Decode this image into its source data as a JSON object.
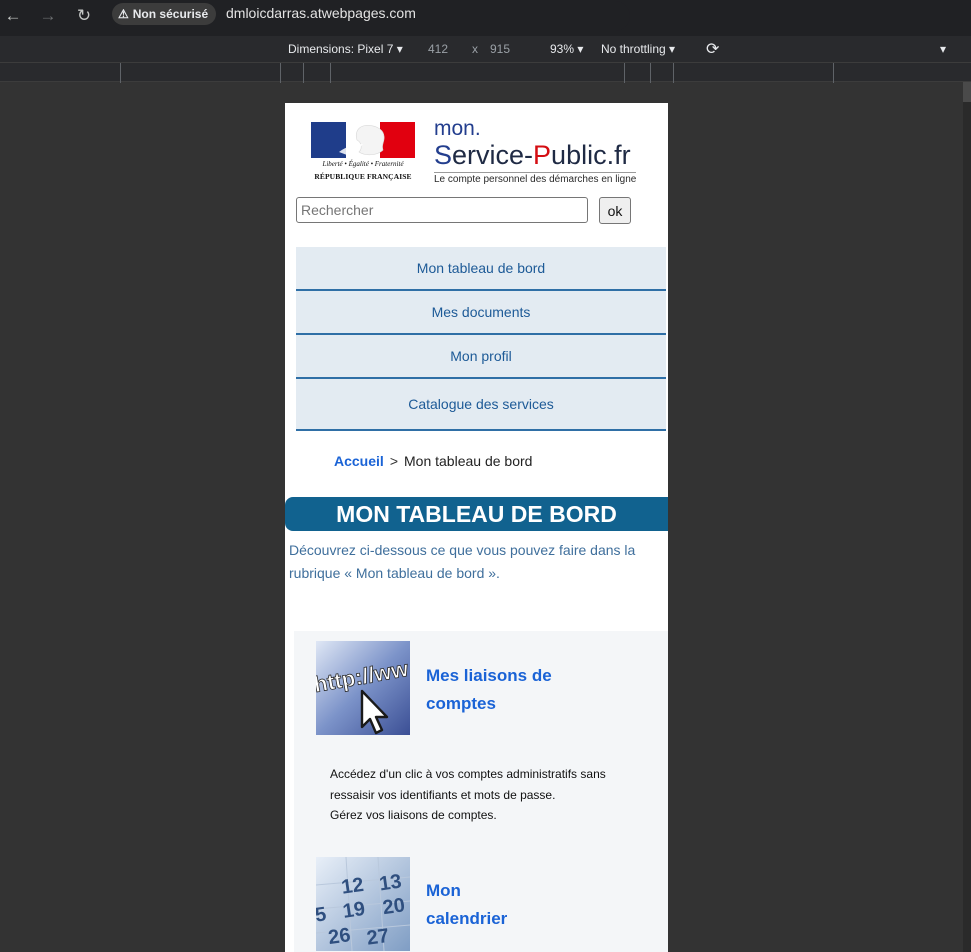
{
  "browser": {
    "security_label": "Non sécurisé",
    "url": "dmloicdarras.atwebpages.com"
  },
  "devtools": {
    "dimensions_label": "Dimensions: Pixel 7",
    "width": "412",
    "times": "x",
    "height": "915",
    "zoom": "93%",
    "throttling": "No throttling"
  },
  "header": {
    "rf_motto": "Liberté • Égalité • Fraternité",
    "rf_name": "RÉPUBLIQUE FRANÇAISE",
    "logo_mon": "mon.",
    "logo_s": "S",
    "logo_ervice": "ervice-",
    "logo_p": "P",
    "logo_ublic": "ublic.fr",
    "logo_tagline": "Le compte personnel des démarches en ligne"
  },
  "search": {
    "placeholder": "Rechercher",
    "button_label": "ok"
  },
  "nav": {
    "items": [
      {
        "label": "Mon tableau de bord"
      },
      {
        "label": "Mes documents"
      },
      {
        "label": "Mon profil"
      },
      {
        "label": "Catalogue des services"
      }
    ]
  },
  "breadcrumb": {
    "home": "Accueil",
    "separator": ">",
    "current": "Mon tableau de bord"
  },
  "page": {
    "title": "MON TABLEAU DE BORD",
    "intro": "Découvrez ci-dessous ce que vous pouvez faire dans la rubrique « Mon tableau de bord »."
  },
  "services": [
    {
      "icon": "http-link-icon",
      "title": "Mes liaisons de comptes",
      "desc_lines": [
        "Accédez d'un clic à vos comptes administratifs sans",
        "ressaisir vos identifiants et mots de passe.",
        "Gérez vos liaisons de comptes."
      ]
    },
    {
      "icon": "calendar-icon",
      "title_line1": "Mon",
      "title_line2": "calendrier"
    }
  ],
  "icon_text": {
    "http": "http://ww",
    "cal_n1": "12",
    "cal_n2": "13",
    "cal_n3": "19",
    "cal_n4": "20",
    "cal_n5": "26",
    "cal_n6": "27",
    "cal_n7": "5"
  },
  "colors": {
    "accent": "#1a63d6",
    "title_band": "#11628f",
    "nav_bg": "#e3ebf2",
    "nav_border": "#2f6fa6"
  }
}
